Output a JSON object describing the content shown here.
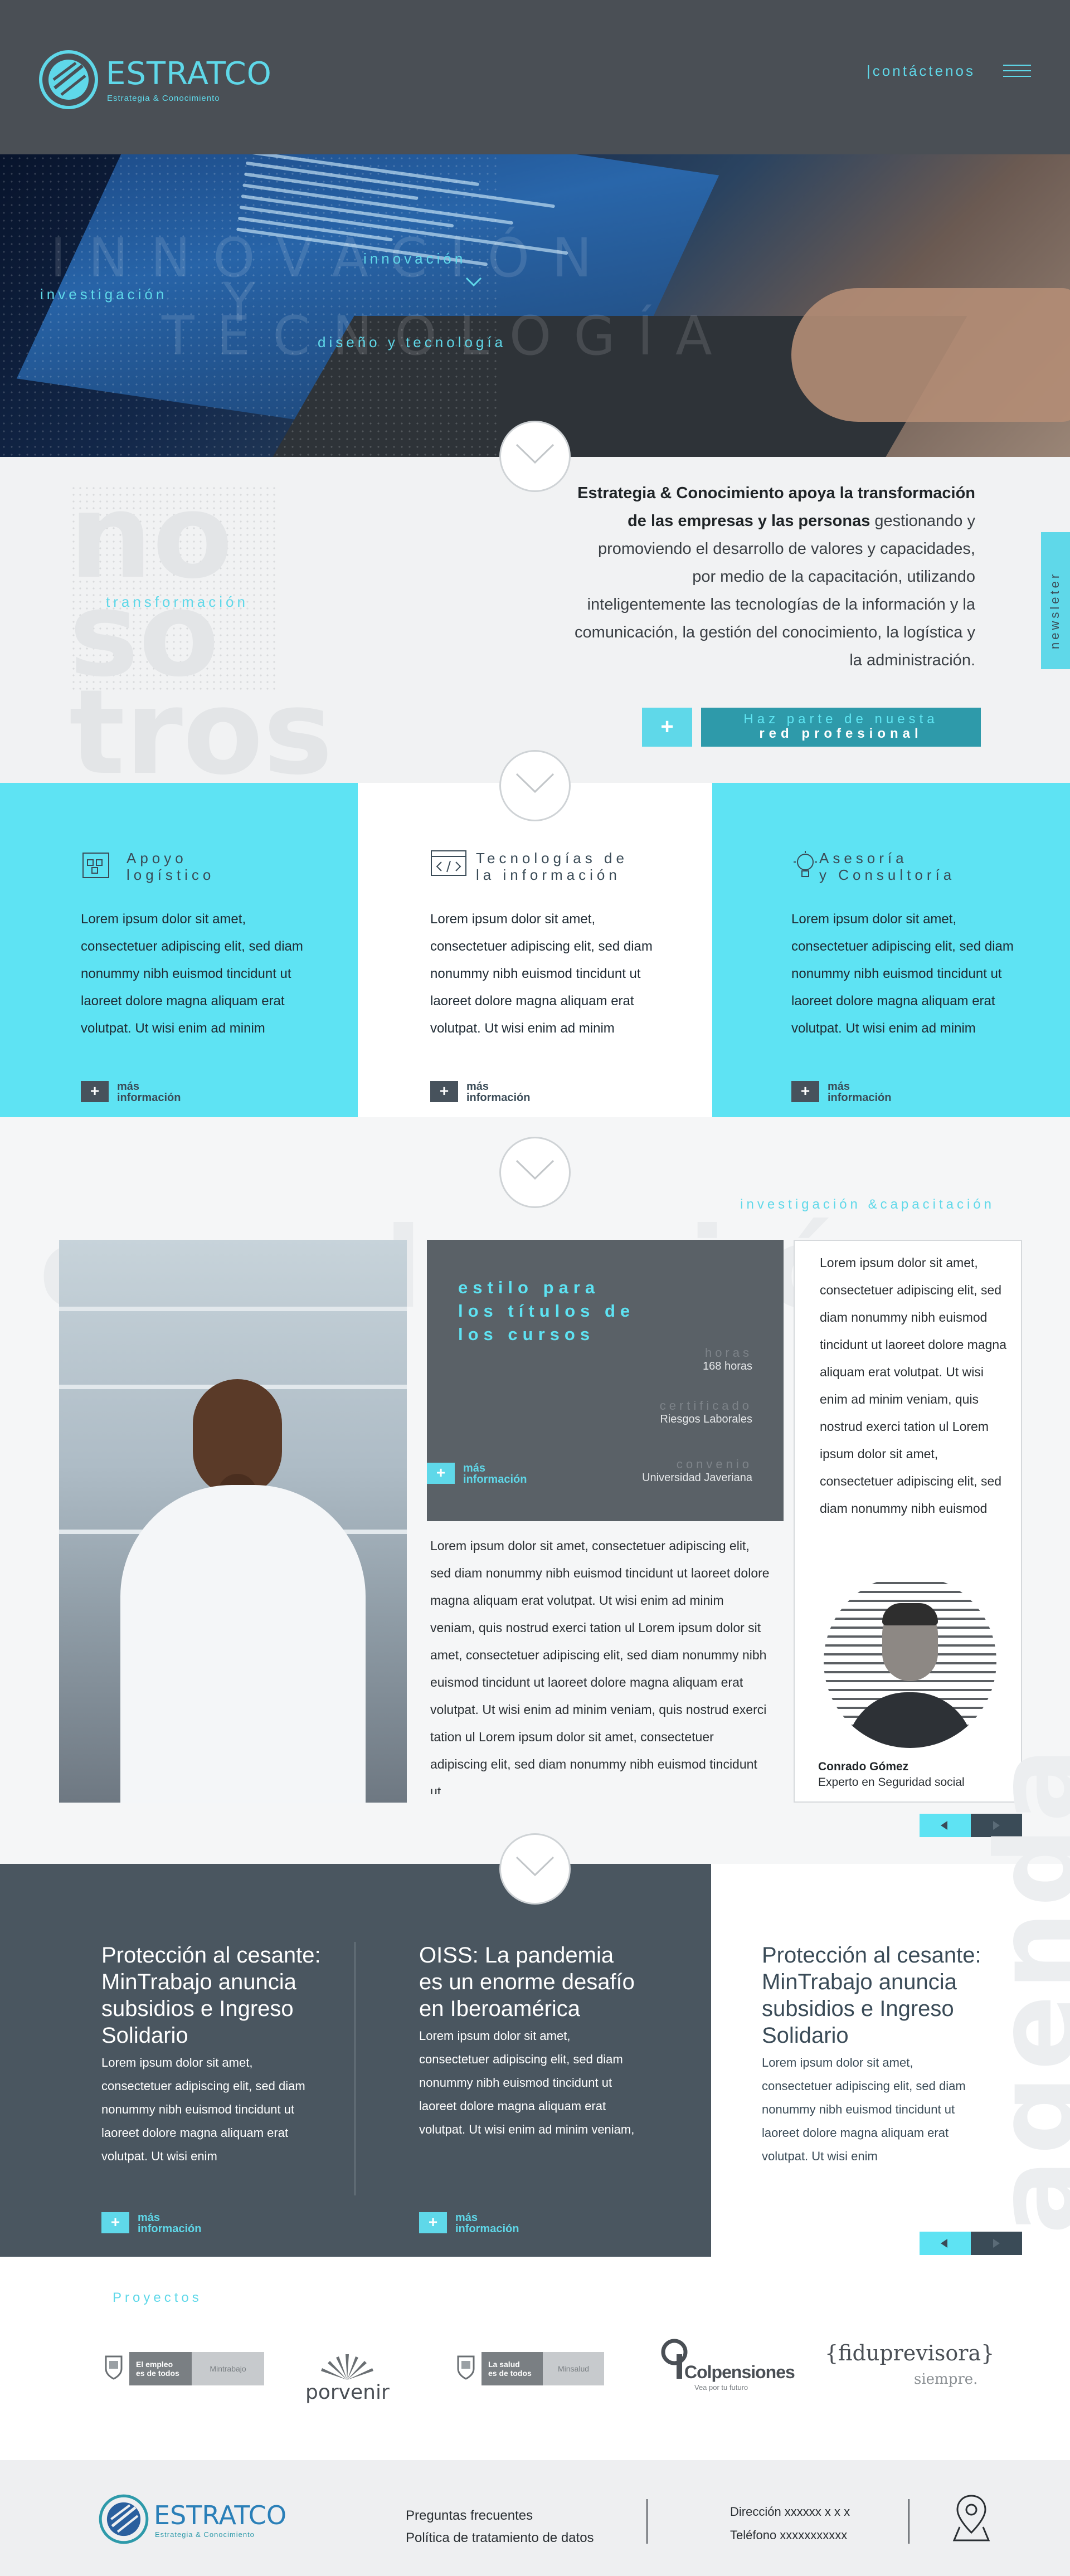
{
  "header": {
    "logo": {
      "name": "ESTRATCO",
      "tagline": "Estrategia & Conocimiento"
    },
    "contact_label": "|contáctenos"
  },
  "hero": {
    "keywords": [
      "innovación",
      "investigación",
      "diseño y tecnología"
    ],
    "ghost_words": [
      "INNOVACIÓN",
      "Y",
      "TECNOLOGÍA"
    ]
  },
  "about": {
    "ghost_lines": [
      "no",
      "so",
      "tros"
    ],
    "keyword": "transformación",
    "text_bold": "Estrategia & Conocimiento apoya la transformación de las empresas y las personas",
    "text_rest": "gestionando y promoviendo el desarrollo de valores y capacidades, por medio de la capacitación, utilizando inteligentemente las tecnologías de la información y la comunicación, la gestión del conocimiento, la logística y la administración.",
    "plus": "+",
    "join_line1": "Haz parte de nuesta",
    "join_line2": "red profesional",
    "newsletter_tab": "newsleter"
  },
  "services": [
    {
      "title_l1": "Apoyo",
      "title_l2": "logístico",
      "icon": "logistics-icon",
      "body": "Lorem ipsum dolor sit amet, consectetuer adipiscing elit, sed diam nonummy nibh euismod tincidunt ut laoreet dolore magna aliquam erat volutpat. Ut wisi enim ad minim veniam,",
      "more_l1": "más",
      "more_l2": "información"
    },
    {
      "title_l1": "Tecnologías de",
      "title_l2": "la información",
      "icon": "code-window-icon",
      "body": "Lorem ipsum dolor sit amet, consectetuer adipiscing elit, sed diam nonummy nibh euismod tincidunt ut laoreet dolore magna aliquam erat volutpat. Ut wisi enim ad minim veniam, quis",
      "more_l1": "más",
      "more_l2": "información"
    },
    {
      "title_l1": "Asesoría",
      "title_l2": "y Consultoría",
      "icon": "lightbulb-icon",
      "body": "Lorem ipsum dolor sit amet, consectetuer adipiscing elit, sed diam nonummy nibh euismod tincidunt ut laoreet dolore magna aliquam erat volutpat. Ut wisi enim ad minim veniam,",
      "more_l1": "más",
      "more_l2": "información"
    }
  ],
  "courses": {
    "ghost": "evolución",
    "keyword": "investigación &capacitación",
    "card": {
      "title_l1": "estilo para",
      "title_l2": "los títulos de",
      "title_l3": "los cursos",
      "hours_label": "horas",
      "hours_value": "168 horas",
      "cert_label": "certificado",
      "cert_value": "Riesgos Laborales",
      "agree_label": "convenio",
      "agree_value": "Universidad Javeriana",
      "more_l1": "más",
      "more_l2": "información"
    },
    "body": "Lorem ipsum dolor sit amet, consectetuer adipiscing elit, sed diam nonummy nibh euismod tincidunt ut laoreet dolore magna aliquam erat volutpat. Ut wisi enim ad minim veniam, quis nostrud exerci tation ul Lorem ipsum dolor sit amet, consectetuer adipiscing elit, sed diam nonummy nibh euismod tincidunt ut laoreet dolore magna aliquam erat volutpat. Ut wisi enim ad minim veniam, quis nostrud exerci tation ul Lorem ipsum dolor sit amet, consectetuer adipiscing elit, sed diam nonummy nibh euismod tincidunt ut",
    "expert": {
      "text": "Lorem ipsum dolor sit amet, consectetuer adipiscing elit, sed diam nonummy nibh euismod tincidunt ut laoreet dolore magna aliquam erat volutpat. Ut wisi enim ad minim veniam, quis nostrud exerci tation ul Lorem ipsum dolor sit amet, consectetuer adipiscing elit, sed diam nonummy nibh euismod",
      "name": "Conrado Gómez",
      "role": "Experto en Seguridad social"
    }
  },
  "news": {
    "ghost": "agenda",
    "items": [
      {
        "title": "Protección al cesante: MinTrabajo anuncia subsidios e Ingreso Solidario",
        "body": "Lorem ipsum dolor sit amet, consectetuer adipiscing elit, sed diam nonummy nibh euismod tincidunt ut laoreet dolore magna aliquam erat volutpat. Ut wisi enim",
        "more_l1": "más",
        "more_l2": "información"
      },
      {
        "title": "OISS: La pandemia es un enorme desafío en Iberoamérica",
        "body": "Lorem ipsum dolor sit amet, consectetuer adipiscing elit, sed diam nonummy nibh euismod tincidunt ut laoreet dolore magna aliquam erat volutpat. Ut wisi enim ad minim veniam, quis nostrud",
        "more_l1": "más",
        "more_l2": "información"
      },
      {
        "title": "Protección al cesante: MinTrabajo anuncia subsidios e Ingreso Solidario",
        "body": "Lorem ipsum dolor sit amet, consectetuer adipiscing elit, sed diam nonummy nibh euismod tincidunt ut laoreet dolore magna aliquam erat volutpat. Ut wisi enim"
      }
    ]
  },
  "projects": {
    "label": "Proyectos",
    "logos": [
      {
        "l1": "El empleo",
        "l2": "es de todos",
        "right": "Mintrabajo"
      },
      {
        "name": "porvenir"
      },
      {
        "l1": "La salud",
        "l2": "es de todos",
        "right": "Minsalud"
      },
      {
        "name": "Colpensiones",
        "sub": "Vea por tu futuro"
      },
      {
        "name": "{fiduprevisora}",
        "sub": "siempre."
      }
    ]
  },
  "footer": {
    "faq": "Preguntas frecuentes",
    "privacy": "Política de tratamiento de datos",
    "address": "Dirección xxxxxx x x  x",
    "phone": "Teléfono   xxxxxxxxxxx"
  },
  "colors": {
    "accent": "#5ee3f3",
    "dark": "#4a4f55",
    "slate": "#4a5660"
  }
}
